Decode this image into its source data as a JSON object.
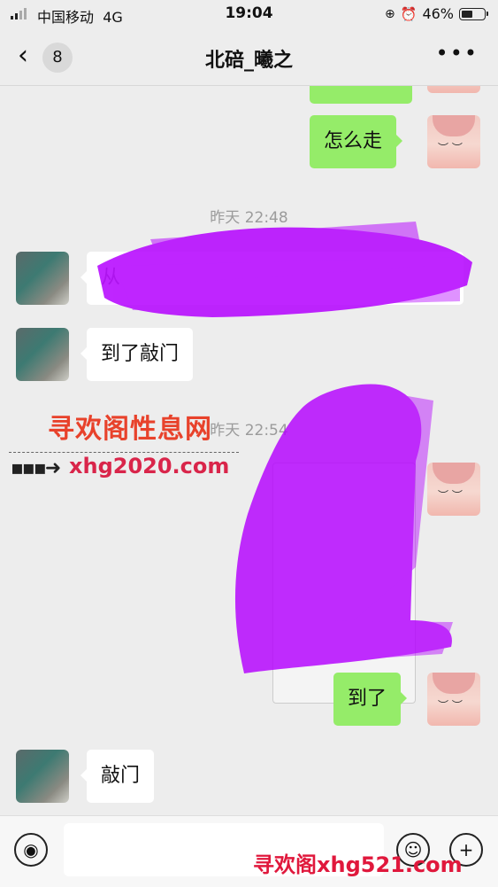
{
  "status_bar": {
    "carrier": "中国移动",
    "network": "4G",
    "time": "19:04",
    "battery": "46%",
    "battery_level": 0.46
  },
  "nav": {
    "back_icon": "chevron-left-icon",
    "unread_count": "8",
    "title": "北碚_曦之",
    "more_icon": "ellipsis-icon"
  },
  "messages": {
    "m1": "怎么走",
    "ts1": "昨天 22:48",
    "m2_visible": "从",
    "m3": "到了敲门",
    "ts2": "昨天 22:54",
    "m4": "到了",
    "m5": "敲门"
  },
  "watermarks": {
    "site_name": "寻欢阁性息网",
    "site_url": "xhg2020.com",
    "footer_mark": "寻欢阁xhg521.com"
  },
  "input_bar": {
    "voice_icon": "voice-icon",
    "emoji_icon": "emoji-icon",
    "add_icon": "plus-icon",
    "input_value": ""
  },
  "colors": {
    "chat_bg": "#ededed",
    "my_bubble": "#95ec69",
    "their_bubble": "#ffffff",
    "redaction": "#b400ff"
  }
}
